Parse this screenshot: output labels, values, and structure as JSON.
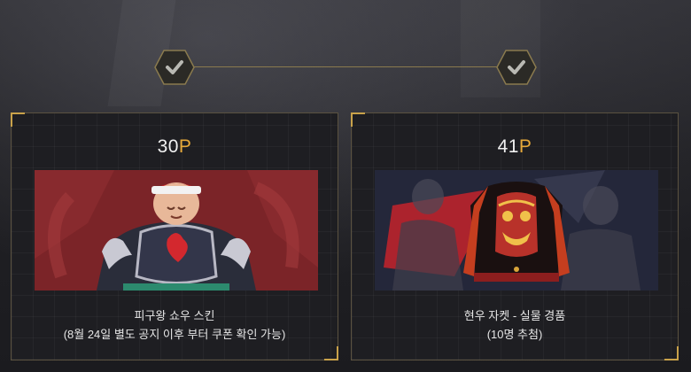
{
  "progress": {
    "steps": [
      {
        "icon": "check-icon",
        "completed": true
      },
      {
        "icon": "check-icon",
        "completed": true
      }
    ]
  },
  "rewards": [
    {
      "points_value": "30",
      "points_unit": "P",
      "image_icon": "character-skin-image",
      "title": "피구왕 쇼우 스킨",
      "note": "(8월 24일 별도 공지 이후 부터 쿠폰 확인 가능)"
    },
    {
      "points_value": "41",
      "points_unit": "P",
      "image_icon": "jacket-merchandise-image",
      "title": "현우 자켓 - 실물 경품",
      "note": "(10명 추첨)"
    }
  ],
  "colors": {
    "accent_gold": "#e7a93a",
    "card_border": "#5b5240",
    "card_art_red": "#8c2a2e",
    "card_art_navy": "#24273a"
  }
}
